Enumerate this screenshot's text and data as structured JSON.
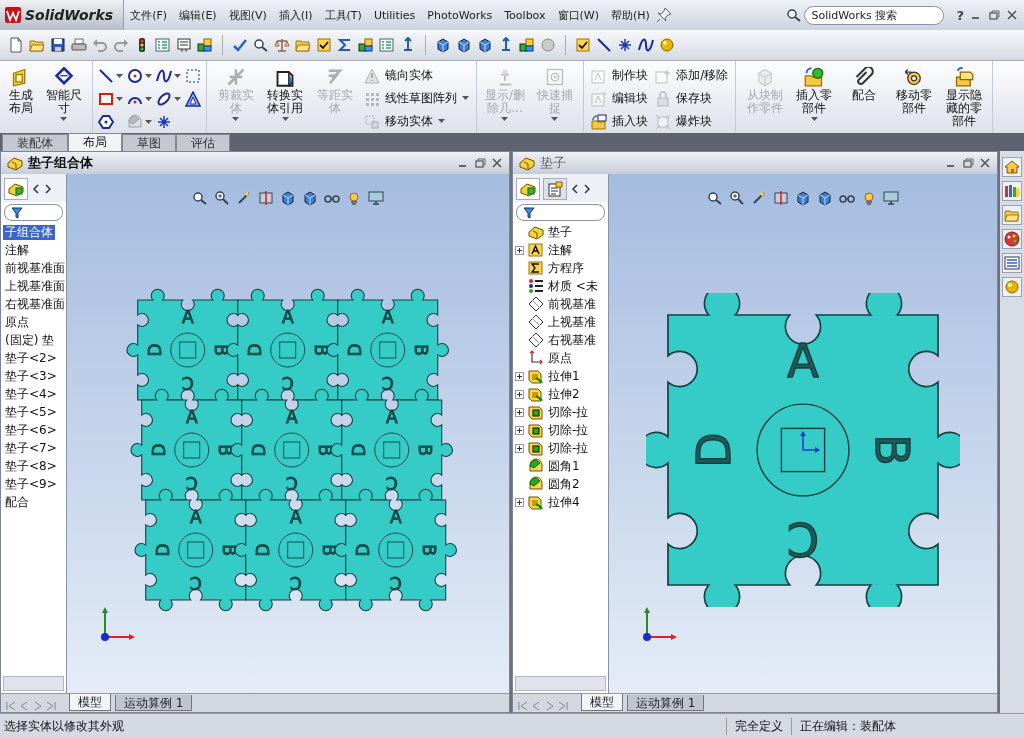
{
  "app": {
    "logo": "SolidWorks"
  },
  "menu": [
    "文件(F)",
    "编辑(E)",
    "视图(V)",
    "插入(I)",
    "工具(T)",
    "Utilities",
    "PhotoWorks",
    "Toolbox",
    "窗口(W)",
    "帮助(H)"
  ],
  "search": {
    "placeholder": "SolidWorks 搜索"
  },
  "help": "?",
  "command_groups": [
    {
      "buttons": [
        {
          "kind": "layout",
          "label": "生成布局",
          "disabled": false,
          "dropdown": false
        },
        {
          "kind": "dimension",
          "label": "智能尺寸",
          "disabled": false,
          "dropdown": true
        }
      ]
    },
    {
      "tools": [
        {
          "kind": "line",
          "disabled": false,
          "dropdown": true
        },
        {
          "kind": "circle",
          "disabled": false,
          "dropdown": true
        },
        {
          "kind": "spline",
          "disabled": false,
          "dropdown": true
        },
        {
          "kind": "construction",
          "disabled": false,
          "dropdown": false
        },
        {
          "kind": "rectangle",
          "disabled": false,
          "dropdown": true
        },
        {
          "kind": "arc",
          "disabled": false,
          "dropdown": true
        },
        {
          "kind": "ellipse",
          "disabled": false,
          "dropdown": true
        },
        {
          "kind": "text",
          "disabled": false,
          "dropdown": false
        },
        {
          "kind": "polygon",
          "disabled": false,
          "dropdown": false
        },
        {
          "kind": "fillet",
          "disabled": true,
          "dropdown": true
        },
        {
          "kind": "point",
          "disabled": false,
          "dropdown": false
        }
      ]
    },
    {
      "buttons": [
        {
          "kind": "trim",
          "label": "剪裁实体",
          "disabled": true,
          "dropdown": true
        },
        {
          "kind": "convert",
          "label": "转换实体引用",
          "disabled": false,
          "dropdown": true
        },
        {
          "kind": "offset",
          "label": "等距实体",
          "disabled": true,
          "dropdown": false
        }
      ],
      "columns": [
        [
          {
            "kind": "mirror",
            "label": "镜向实体",
            "disabled": true,
            "dropdown": false
          },
          {
            "kind": "pattern",
            "label": "线性草图阵列",
            "disabled": true,
            "dropdown": true
          },
          {
            "kind": "move",
            "label": "移动实体",
            "disabled": true,
            "dropdown": true
          }
        ]
      ]
    },
    {
      "buttons": [
        {
          "kind": "display-delete",
          "label": "显示/删除几...",
          "disabled": true,
          "dropdown": true
        },
        {
          "kind": "snap",
          "label": "快速捕捉",
          "disabled": true,
          "dropdown": true
        }
      ]
    },
    {
      "columns": [
        [
          {
            "kind": "make-block",
            "label": "制作块",
            "disabled": true,
            "dropdown": false
          },
          {
            "kind": "edit-block",
            "label": "编辑块",
            "disabled": true,
            "dropdown": false
          },
          {
            "kind": "insert-block",
            "label": "插入块",
            "disabled": false,
            "dropdown": false
          }
        ],
        [
          {
            "kind": "add-remove",
            "label": "添加/移除",
            "disabled": true,
            "dropdown": false
          },
          {
            "kind": "save-block",
            "label": "保存块",
            "disabled": true,
            "dropdown": false
          },
          {
            "kind": "explode-block",
            "label": "爆炸块",
            "disabled": true,
            "dropdown": false
          }
        ]
      ]
    },
    {
      "buttons": [
        {
          "kind": "from-block",
          "label": "从块制作零件",
          "disabled": true,
          "dropdown": false
        },
        {
          "kind": "insert-component",
          "label": "插入零部件",
          "disabled": false,
          "dropdown": true
        },
        {
          "kind": "mate",
          "label": "配合",
          "disabled": false,
          "dropdown": false
        },
        {
          "kind": "move-component",
          "label": "移动零部件",
          "disabled": false,
          "dropdown": false
        },
        {
          "kind": "show-hidden",
          "label": "显示隐藏的零部件",
          "disabled": false,
          "dropdown": false
        }
      ]
    }
  ],
  "cm_tabs": [
    {
      "label": "装配体",
      "selected": false
    },
    {
      "label": "布局",
      "selected": true
    },
    {
      "label": "草图",
      "selected": false
    },
    {
      "label": "评估",
      "selected": false
    }
  ],
  "windows": [
    {
      "title": "垫子组合体",
      "active": true,
      "tree": {
        "tabs": [
          {
            "kind": "feature-tree",
            "selected": true
          }
        ],
        "items": [
          {
            "kind": "text",
            "label": "子组合体",
            "selected": true
          },
          {
            "kind": "text",
            "label": "注解",
            "selected": false
          },
          {
            "kind": "text",
            "label": "前视基准面",
            "selected": false
          },
          {
            "kind": "text",
            "label": "上视基准面",
            "selected": false
          },
          {
            "kind": "text",
            "label": "右视基准面",
            "selected": false
          },
          {
            "kind": "text",
            "label": "原点",
            "selected": false
          },
          {
            "kind": "text",
            "label": "(固定) 垫",
            "selected": false
          },
          {
            "kind": "text",
            "label": "垫子<2>",
            "selected": false
          },
          {
            "kind": "text",
            "label": "垫子<3>",
            "selected": false
          },
          {
            "kind": "text",
            "label": "垫子<4>",
            "selected": false
          },
          {
            "kind": "text",
            "label": "垫子<5>",
            "selected": false
          },
          {
            "kind": "text",
            "label": "垫子<6>",
            "selected": false
          },
          {
            "kind": "text",
            "label": "垫子<7>",
            "selected": false
          },
          {
            "kind": "text",
            "label": "垫子<8>",
            "selected": false
          },
          {
            "kind": "text",
            "label": "垫子<9>",
            "selected": false
          },
          {
            "kind": "text",
            "label": "配合",
            "selected": false
          }
        ]
      },
      "model": {
        "kind": "grid",
        "pieces": [
          {
            "top": "A",
            "right": "B",
            "bottom": "C",
            "left": "D"
          },
          {
            "top": "A",
            "right": "B",
            "bottom": "C",
            "left": "D"
          },
          {
            "top": "A",
            "right": "B",
            "bottom": "C",
            "left": "D"
          },
          {
            "top": "A",
            "right": "B",
            "bottom": "C",
            "left": "D"
          },
          {
            "top": "A",
            "right": "B",
            "bottom": "C",
            "left": "D"
          },
          {
            "top": "A",
            "right": "B",
            "bottom": "C",
            "left": "D"
          },
          {
            "top": "A",
            "right": "B",
            "bottom": "C",
            "left": "D"
          },
          {
            "top": "A",
            "right": "B",
            "bottom": "C",
            "left": "D"
          },
          {
            "top": "A",
            "right": "B",
            "bottom": "C",
            "left": "D"
          }
        ]
      },
      "bottom_tabs": [
        {
          "label": "模型",
          "selected": true
        },
        {
          "label": "运动算例 1",
          "selected": false
        }
      ]
    },
    {
      "title": "垫子",
      "active": false,
      "tree": {
        "tabs": [
          {
            "kind": "feature-tree",
            "selected": true
          },
          {
            "kind": "properties",
            "selected": false
          }
        ],
        "items": [
          {
            "kind": "part",
            "label": "垫子",
            "selected": false
          },
          {
            "kind": "annotation",
            "label": "注解",
            "selected": false,
            "expanded": false
          },
          {
            "kind": "equation",
            "label": "方程序",
            "selected": false
          },
          {
            "kind": "material",
            "label": "材质 <未",
            "selected": false
          },
          {
            "kind": "plane",
            "label": "前视基准",
            "selected": false
          },
          {
            "kind": "plane",
            "label": "上视基准",
            "selected": false
          },
          {
            "kind": "plane",
            "label": "右视基准",
            "selected": false
          },
          {
            "kind": "origin",
            "label": "原点",
            "selected": false
          },
          {
            "kind": "extrude",
            "label": "拉伸1",
            "selected": false,
            "expanded": false
          },
          {
            "kind": "extrude",
            "label": "拉伸2",
            "selected": false,
            "expanded": false
          },
          {
            "kind": "cut",
            "label": "切除-拉",
            "selected": false,
            "expanded": false
          },
          {
            "kind": "cut",
            "label": "切除-拉",
            "selected": false,
            "expanded": false
          },
          {
            "kind": "cut",
            "label": "切除-拉",
            "selected": false,
            "expanded": false
          },
          {
            "kind": "fillet",
            "label": "圆角1",
            "selected": false
          },
          {
            "kind": "fillet",
            "label": "圆角2",
            "selected": false
          },
          {
            "kind": "extrude",
            "label": "拉伸4",
            "selected": false,
            "expanded": false
          }
        ]
      },
      "model": {
        "kind": "single",
        "pieces": [
          {
            "top": "A",
            "right": "B",
            "bottom": "C",
            "left": "D"
          }
        ]
      },
      "bottom_tabs": [
        {
          "label": "模型",
          "selected": true
        },
        {
          "label": "运动算例 1",
          "selected": false
        }
      ]
    }
  ],
  "status_bar": {
    "message": "选择实体以修改其外观",
    "sections": [
      "完全定义",
      "正在编辑：装配体"
    ]
  }
}
